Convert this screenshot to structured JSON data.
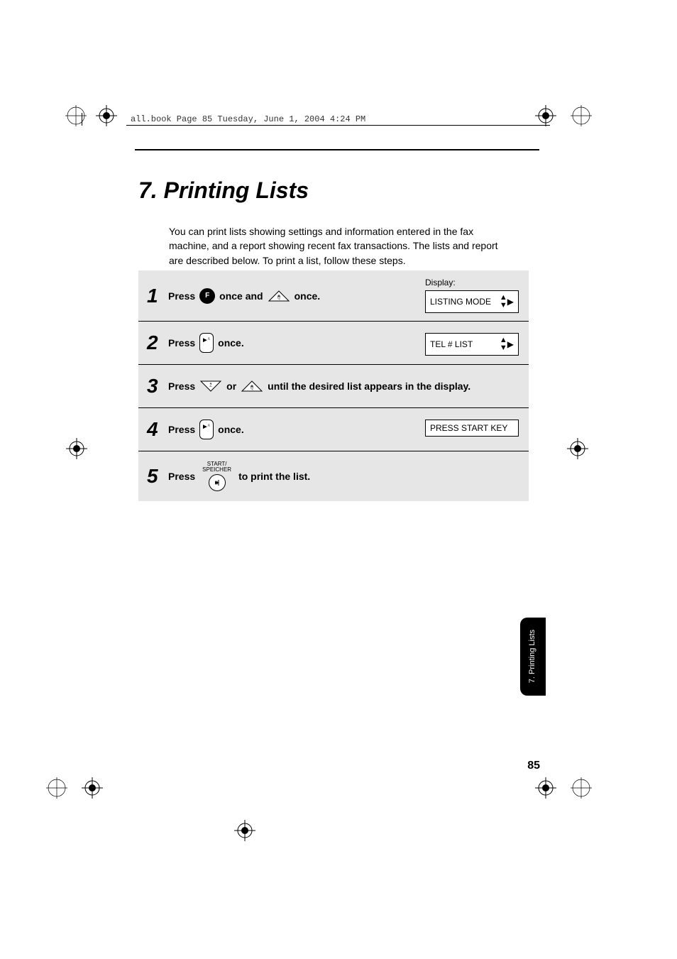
{
  "header": {
    "breadcrumb": "all.book  Page 85  Tuesday, June 1, 2004  4:24 PM"
  },
  "chapter": {
    "title": "7.  Printing Lists"
  },
  "intro": "You can print lists showing settings and information entered in the fax machine, and a report showing recent fax transactions. The lists and report are described below. To print a list, follow these steps.",
  "steps": [
    {
      "num": "1",
      "text_a": "Press",
      "key_f": "F",
      "text_b": "once and",
      "text_c": "once.",
      "display_label": "Display:",
      "display_value": "LISTING MODE"
    },
    {
      "num": "2",
      "text_a": "Press",
      "text_c": "once.",
      "display_value": "TEL # LIST"
    },
    {
      "num": "3",
      "text_a": "Press",
      "text_or": "or",
      "text_c": "until the desired list appears in the display."
    },
    {
      "num": "4",
      "text_a": "Press",
      "text_c": "once.",
      "display_value": "PRESS START KEY"
    },
    {
      "num": "5",
      "text_a": "Press",
      "start_label_1": "START/",
      "start_label_2": "SPEICHER",
      "text_c": "to print the list."
    }
  ],
  "thumb_tab": "7. Printing\nLists",
  "page_number": "85"
}
